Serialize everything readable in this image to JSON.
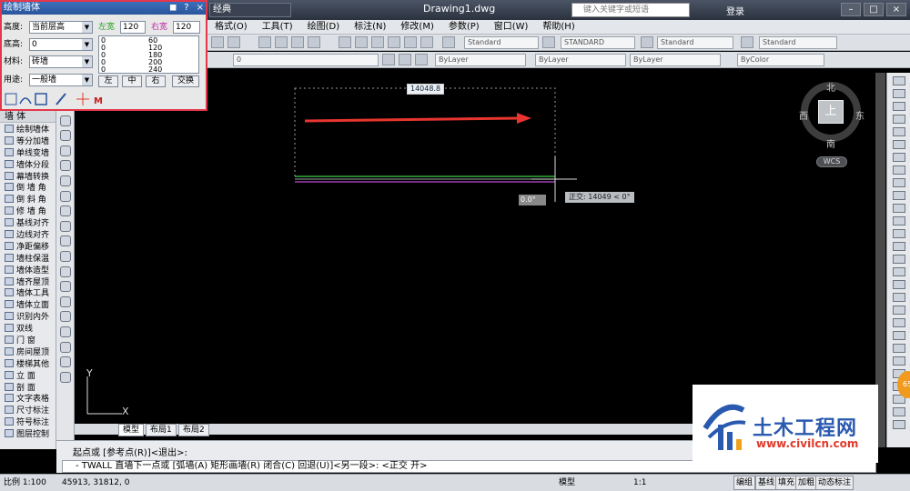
{
  "titlebar": {
    "workspace": "经典",
    "document_title": "Drawing1.dwg",
    "search_placeholder": "键入关键字或短语",
    "login_label": "登录"
  },
  "menubar": {
    "items": [
      "格式(O)",
      "工具(T)",
      "绘图(D)",
      "标注(N)",
      "修改(M)",
      "参数(P)",
      "窗口(W)",
      "帮助(H)"
    ]
  },
  "toolbar": {
    "text_style": "Standard",
    "dim_style": "STANDARD",
    "table_style": "Standard",
    "mleader_style": "Standard",
    "layer_value": "0",
    "color": "ByLayer",
    "linetype": "ByLayer",
    "lineweight": "ByLayer",
    "plotstyle": "ByColor"
  },
  "dialog": {
    "title": "绘制墙体",
    "height_label": "高度:",
    "height_value": "当前层高",
    "bottom_label": "底高:",
    "bottom_value": "0",
    "material_label": "材料:",
    "material_value": "砖墙",
    "usage_label": "用途:",
    "usage_value": "一般墙",
    "left_width_label": "左宽",
    "left_width_value": "120",
    "right_width_label": "右宽",
    "right_width_value": "120",
    "width_list_left": [
      "0",
      "0",
      "0",
      "0",
      "0"
    ],
    "width_list_right": [
      "60",
      "120",
      "180",
      "200",
      "240"
    ],
    "buttons": [
      "左",
      "中",
      "右",
      "交换"
    ]
  },
  "sidebar": {
    "header": "墙    体",
    "items": [
      "绘制墙体",
      "等分加墙",
      "单线变墙",
      "墙体分段",
      "幕墙转换",
      "倒 墙 角",
      "倒 斜 角",
      "修 墙 角",
      "基线对齐",
      "边线对齐",
      "净距偏移",
      "墙柱保温",
      "墙体造型",
      "墙齐屋顶",
      "墙体工具",
      "墙体立面",
      "识别内外",
      "双线",
      "门    窗",
      "房间屋顶",
      "楼梯其他",
      "立    面",
      "剖    面",
      "文字表格",
      "尺寸标注",
      "符号标注",
      "图层控制"
    ]
  },
  "canvas": {
    "dimension_value": "14048.8",
    "angle_input": "0.0°",
    "ortho_tooltip": "正交: 14049 < 0°",
    "ucs_y": "Y",
    "ucs_x": "X",
    "viewcube_top": "上",
    "compass_n": "北",
    "compass_s": "南",
    "compass_e": "东",
    "compass_w": "西",
    "wcs": "WCS"
  },
  "layout_tabs": [
    "模型",
    "布局1",
    "布局2"
  ],
  "command": {
    "line1": "起点或 [参考点(R)]<退出>:",
    "line2": "- TWALL 直墙下一点或 [弧墙(A) 矩形画墙(R) 闭合(C) 回退(U)]<另一段>: <正交 开>"
  },
  "status": {
    "scale": "比例 1:100",
    "coords": "45913, 31812, 0",
    "model": "模型",
    "annotation_scale": "1:1",
    "buttons": [
      "编组",
      "基线",
      "填充",
      "加粗",
      "动态标注"
    ]
  },
  "logo": {
    "title": "土木工程网",
    "url": "www.civilcn.com"
  },
  "colors": {
    "arrow": "#e8352f",
    "dialog_border": "#e4374b",
    "wall_green": "#3fd14a",
    "wall_magenta": "#c24bd6"
  }
}
